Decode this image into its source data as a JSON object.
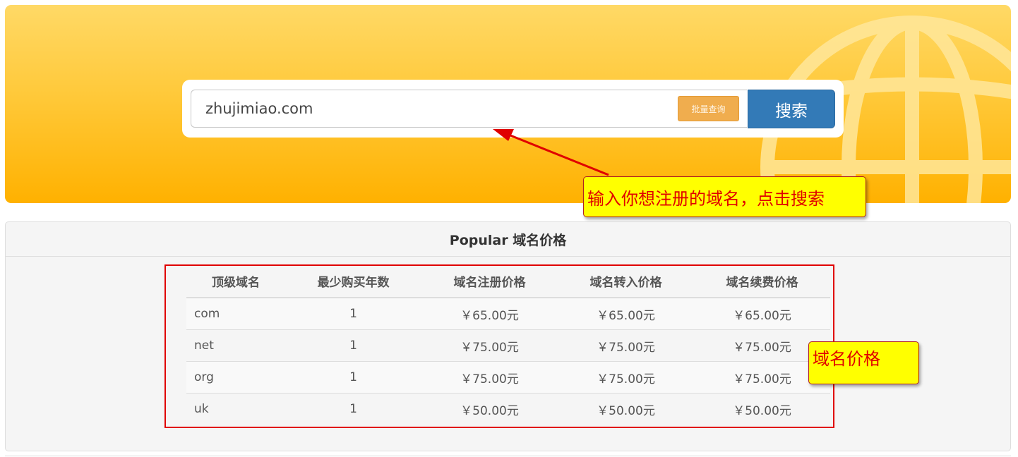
{
  "search": {
    "value": "zhujimiao.com",
    "batch_button_label": "批量查询",
    "search_button_label": "搜索"
  },
  "price_panel": {
    "title": "Popular 域名价格",
    "columns": [
      "顶级域名",
      "最少购买年数",
      "域名注册价格",
      "域名转入价格",
      "域名续费价格"
    ],
    "rows": [
      {
        "tld": "com",
        "min_years": "1",
        "register": "￥65.00元",
        "transfer": "￥65.00元",
        "renew": "￥65.00元"
      },
      {
        "tld": "net",
        "min_years": "1",
        "register": "￥75.00元",
        "transfer": "￥75.00元",
        "renew": "￥75.00元"
      },
      {
        "tld": "org",
        "min_years": "1",
        "register": "￥75.00元",
        "transfer": "￥75.00元",
        "renew": "￥75.00元"
      },
      {
        "tld": "uk",
        "min_years": "1",
        "register": "￥50.00元",
        "transfer": "￥50.00元",
        "renew": "￥50.00元"
      }
    ]
  },
  "annotations": {
    "search_callout": "输入你想注册的域名，点击搜索",
    "table_callout": "域名价格"
  },
  "colors": {
    "banner_top": "#ffd966",
    "banner_bottom": "#ffb100",
    "search_button": "#337ab7",
    "batch_button": "#f0ad4e",
    "annotation_red": "#e00000",
    "callout_yellow": "#ffff00"
  },
  "icons": {
    "banner_decoration": "globe-icon",
    "annotation_pointer": "arrow"
  }
}
